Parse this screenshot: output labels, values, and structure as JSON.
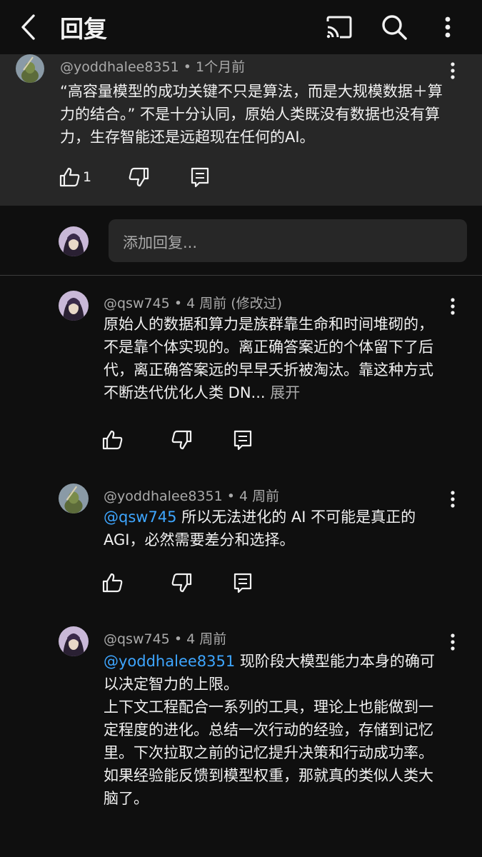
{
  "header": {
    "title": "回复",
    "icons": [
      "back-arrow-icon",
      "cast-icon",
      "search-icon",
      "more-vert-icon"
    ]
  },
  "parent_comment": {
    "author": "@yoddhalee8351",
    "time": "1个月前",
    "text": "“高容量模型的成功关键不只是算法，而是大规模数据＋算力的结合。” 不是十分认同，原始人类既没有数据也没有算力，生存智能还是远超现在任何的AI。",
    "likes": "1"
  },
  "add_reply": {
    "placeholder": "添加回复..."
  },
  "replies": [
    {
      "author": "@qsw745",
      "time": "4 周前 (修改过)",
      "text": "原始人的数据和算力是族群靠生命和时间堆砌的，不是靠个体实现的。离正确答案近的个体留下了后代，离正确答案远的早早夭折被淘汰。靠这种方式不断迭代优化人类 DN...",
      "expand": "展开"
    },
    {
      "author": "@yoddhalee8351",
      "time": "4 周前",
      "mention": "@qsw745",
      "text": " 所以无法进化的 AI 不可能是真正的 AGI，必然需要差分和选择。"
    },
    {
      "author": "@qsw745",
      "time": "4 周前",
      "mention": "@yoddhalee8351",
      "text": " 现阶段大模型能力本身的确可以决定智力的上限。\n上下文工程配合一系列的工具，理论上也能做到一定程度的进化。总结一次行动的经验，存储到记忆里。下次拉取之前的记忆提升决策和行动成功率。\n如果经验能反馈到模型权重，那就真的类似人类大脑了。"
    }
  ],
  "separator": "•",
  "colors": {
    "background": "#0f0f0f",
    "highlight": "#272727",
    "mention": "#3ea6ff",
    "secondary_text": "#aaaaaa"
  }
}
